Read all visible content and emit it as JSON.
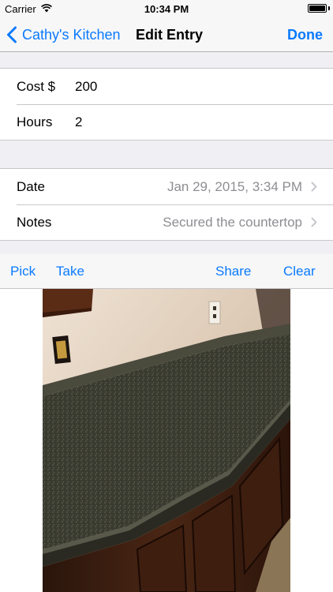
{
  "status_bar": {
    "carrier": "Carrier",
    "time": "10:34 PM",
    "wifi_icon": "wifi-icon",
    "battery_icon": "battery-icon"
  },
  "nav": {
    "back_label": "Cathy's Kitchen",
    "back_icon": "chevron-left-icon",
    "title": "Edit Entry",
    "done_label": "Done",
    "accent": "#0a7aff"
  },
  "cost_group": {
    "cost_label": "Cost $",
    "cost_value": "200",
    "hours_label": "Hours",
    "hours_value": "2"
  },
  "detail_group": {
    "date_label": "Date",
    "date_value": "Jan 29, 2015, 3:34 PM",
    "notes_label": "Notes",
    "notes_value": "Secured the countertop"
  },
  "photo_toolbar": {
    "pick_label": "Pick",
    "take_label": "Take",
    "share_label": "Share",
    "clear_label": "Clear"
  },
  "photo": {
    "subject": "kitchen countertop photo"
  }
}
